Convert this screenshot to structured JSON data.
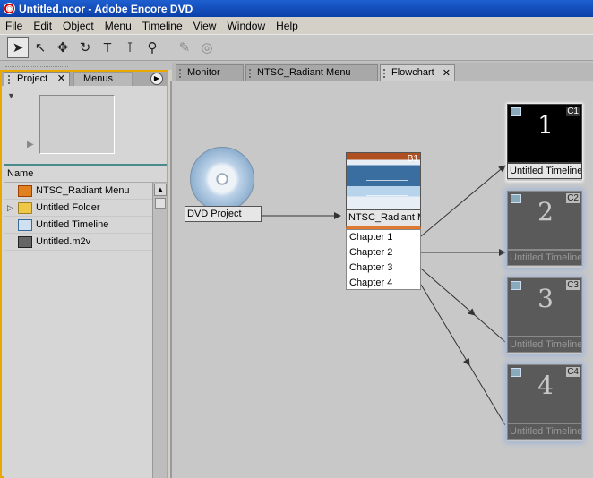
{
  "window": {
    "title": "Untitled.ncor - Adobe Encore DVD",
    "icon": "encore-app-icon"
  },
  "menubar": [
    "File",
    "Edit",
    "Object",
    "Menu",
    "Timeline",
    "View",
    "Window",
    "Help"
  ],
  "toolbar": {
    "tools": [
      "selection-arrow",
      "direct-select-arrow",
      "move-tool",
      "rotate-tool",
      "text-tool",
      "vertical-text-tool",
      "zoom-tool",
      "preview-tool",
      "link-tool"
    ]
  },
  "project_panel": {
    "tabs": [
      {
        "label": "Project",
        "active": true
      },
      {
        "label": "Menus",
        "active": false
      }
    ],
    "column_name": "Name",
    "items": [
      {
        "label": "NTSC_Radiant Menu",
        "icon": "menu-icon"
      },
      {
        "label": "Untitled Folder",
        "icon": "folder-icon"
      },
      {
        "label": "Untitled Timeline",
        "icon": "timeline-icon"
      },
      {
        "label": "Untitled.m2v",
        "icon": "video-file-icon"
      }
    ]
  },
  "editor_tabs": [
    {
      "label": "Monitor",
      "active": false
    },
    {
      "label": "NTSC_Radiant Menu",
      "active": false
    },
    {
      "label": "Flowchart",
      "active": true
    }
  ],
  "flowchart": {
    "dvd_project": "DVD Project",
    "menu": {
      "label": "NTSC_Radiant Menu",
      "tag": "B1"
    },
    "chapters": [
      "Chapter 1",
      "Chapter 2",
      "Chapter 3",
      "Chapter 4"
    ],
    "timelines": [
      {
        "number": "1",
        "tag": "C1",
        "label": "Untitled Timeline"
      },
      {
        "number": "2",
        "tag": "C2",
        "label": "Untitled Timeline"
      },
      {
        "number": "3",
        "tag": "C3",
        "label": "Untitled Timeline"
      },
      {
        "number": "4",
        "tag": "C4",
        "label": "Untitled Timeline"
      }
    ]
  }
}
